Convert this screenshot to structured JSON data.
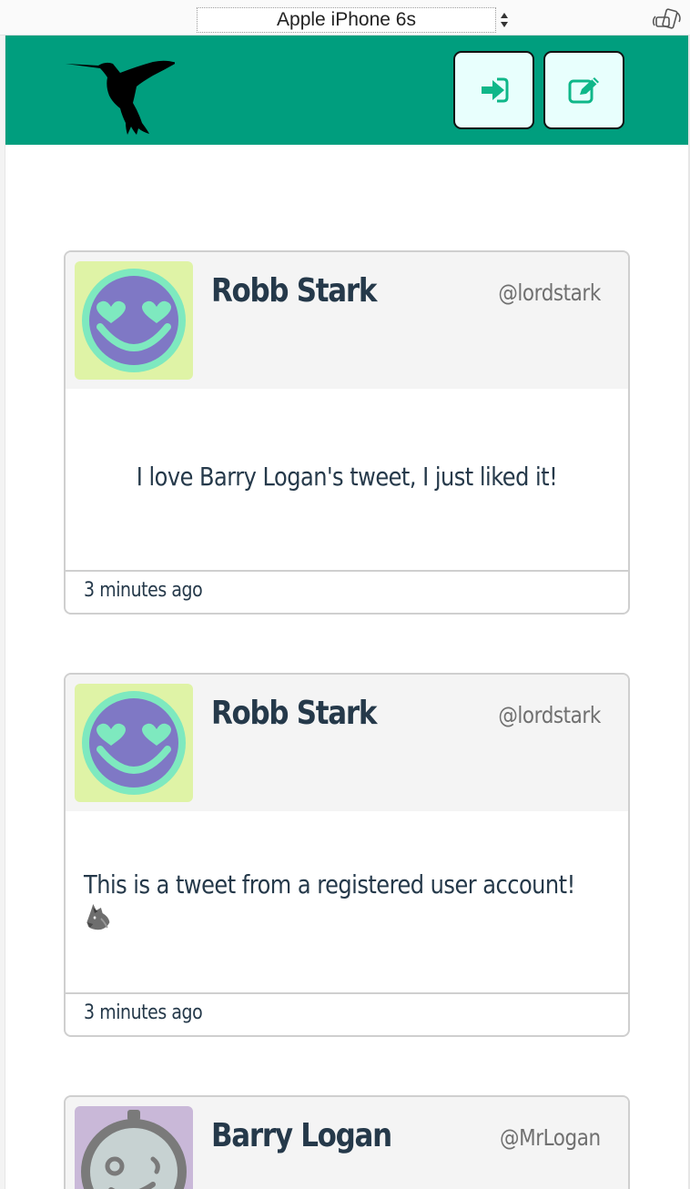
{
  "device_toolbar": {
    "device_name": "Apple iPhone 6s"
  },
  "header": {
    "logo": "hummingbird-logo",
    "logout_icon": "sign-out-icon",
    "compose_icon": "edit-icon",
    "brand_color": "#009e7e"
  },
  "tweets": [
    {
      "name": "Robb Stark",
      "handle": "@lordstark",
      "text": "I love Barry Logan's tweet, I just liked it!",
      "time": "3 minutes ago",
      "avatar": "heart-eyes-smiley-avatar"
    },
    {
      "name": "Robb Stark",
      "handle": "@lordstark",
      "text": "This is a tweet from a registered user account!",
      "emoji": "wolf-icon",
      "time": "3 minutes ago",
      "avatar": "heart-eyes-smiley-avatar"
    },
    {
      "name": "Barry Logan",
      "handle": "@MrLogan",
      "avatar": "robot-face-avatar"
    }
  ]
}
